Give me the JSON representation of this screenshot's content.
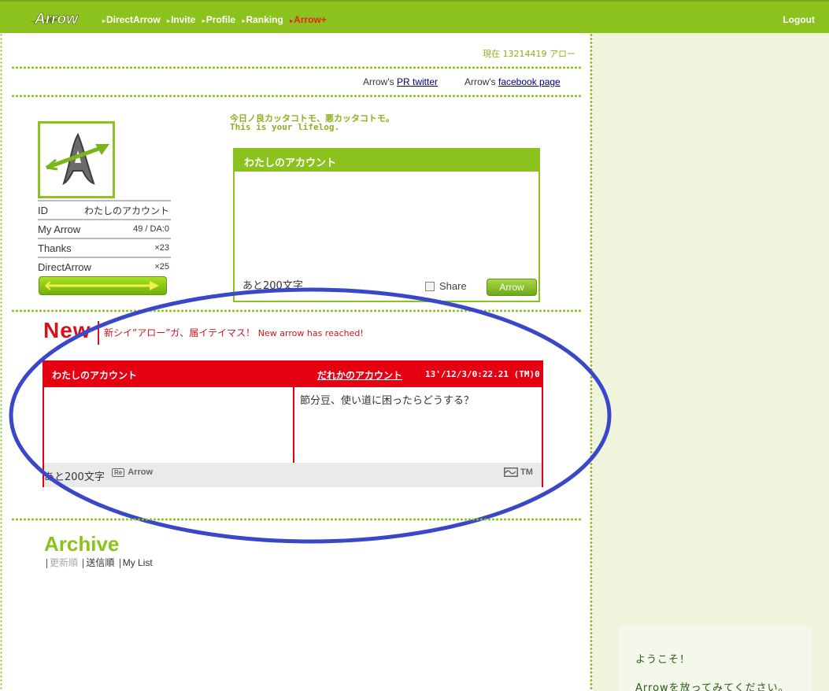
{
  "nav": {
    "items": [
      "DirectArrow",
      "Invite",
      "Profile",
      "Ranking"
    ],
    "highlight_item": "Arrow+",
    "logout": "Logout"
  },
  "points": {
    "text": "現在 13214419 アロー"
  },
  "external_links": {
    "twitter_prefix": "Arrow's",
    "twitter_link": "PR twitter",
    "facebook_prefix": "Arrow's",
    "facebook_link": "facebook page"
  },
  "profile": {
    "id_label": "ID",
    "id_value": "わたしのアカウント",
    "my_arrow_label": "My Arrow",
    "my_arrow_value": "49 / DA:0",
    "thanks_label": "Thanks",
    "thanks_value": "×23",
    "direct_arrow_label": "DirectArrow",
    "direct_arrow_value": "×25"
  },
  "lifelog": {
    "tagline_jp": "今日ノ良カッタコトモ、悪カッタコトモ。",
    "tagline_en": "This is your lifelog."
  },
  "composer": {
    "title": "わたしのアカウント",
    "remaining": "あと200文字",
    "share_label": "Share",
    "arrow_button": "Arrow"
  },
  "new_arrow": {
    "title": "New",
    "message_jp": "新シイ”アロー”ガ、届イテイマス！",
    "message_en": "New arrow has reached!"
  },
  "arrow_card": {
    "me": "わたしのアカウント",
    "them": "だれかのアカウント",
    "timestamp": "13'/12/3/0:22.21 (TM)0",
    "message": "節分豆、使い道に困ったらどうする？",
    "remaining": "あと200文字",
    "reply_label": "Arrow",
    "reply_icon": "Re",
    "tm_label": "TM"
  },
  "archive": {
    "title": "Archive",
    "tabs": [
      "更新順",
      "送信順",
      "My List"
    ]
  },
  "welcome": {
    "line1": "ようこそ！",
    "line2": "Arrowを放ってみてください。"
  },
  "colors": {
    "brand_green": "#8bc21d",
    "alert_red": "#e50012",
    "annotation_blue": "#3a47c9"
  }
}
